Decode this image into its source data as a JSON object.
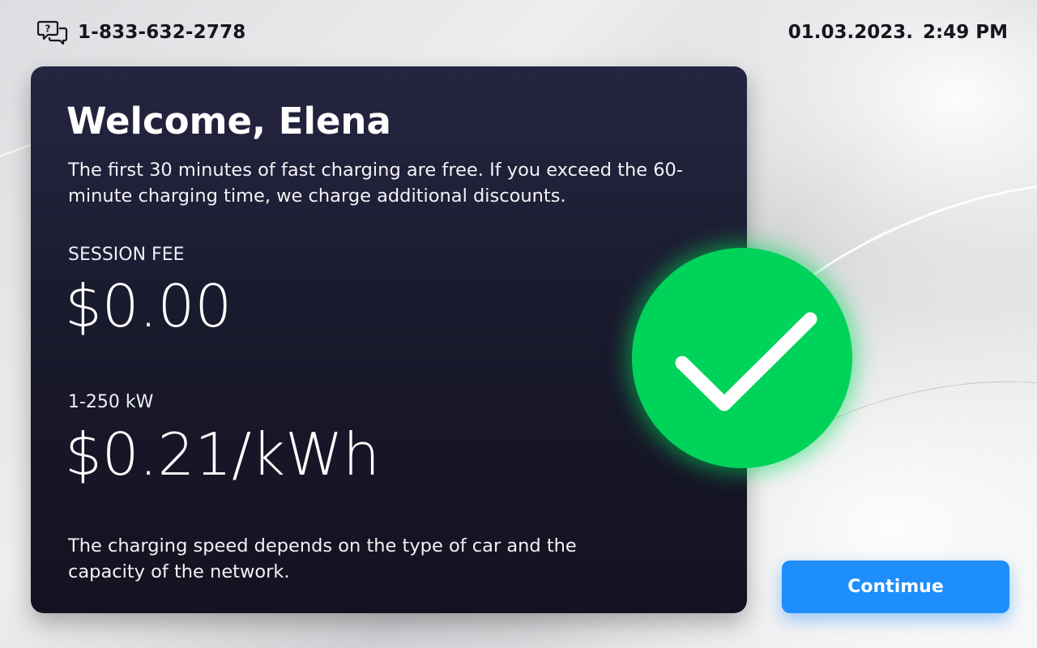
{
  "header": {
    "phone_icon": "support-chat-icon",
    "phone_number": "1-833-632-2778",
    "date": "01.03.2023.",
    "time": "2:49 PM"
  },
  "card": {
    "welcome_title": "Welcome, Elena",
    "intro_text": "The first 30 minutes of fast charging are free. If you exceed the 60-minute charging time, we charge additional discounts.",
    "session_fee_label": "SESSION FEE",
    "session_fee_value": "$0.00",
    "rate_label": "1-250 kW",
    "rate_value": "$0.21/kWh",
    "footnote": "The charging speed depends on the type of car and the capacity of the network."
  },
  "status": {
    "icon": "checkmark-icon",
    "color": "#00d35a"
  },
  "actions": {
    "continue_label": "Contimue",
    "button_color": "#1e8efb"
  },
  "theme": {
    "card_color": "#1a1a2e",
    "text_dark": "#15151c"
  }
}
